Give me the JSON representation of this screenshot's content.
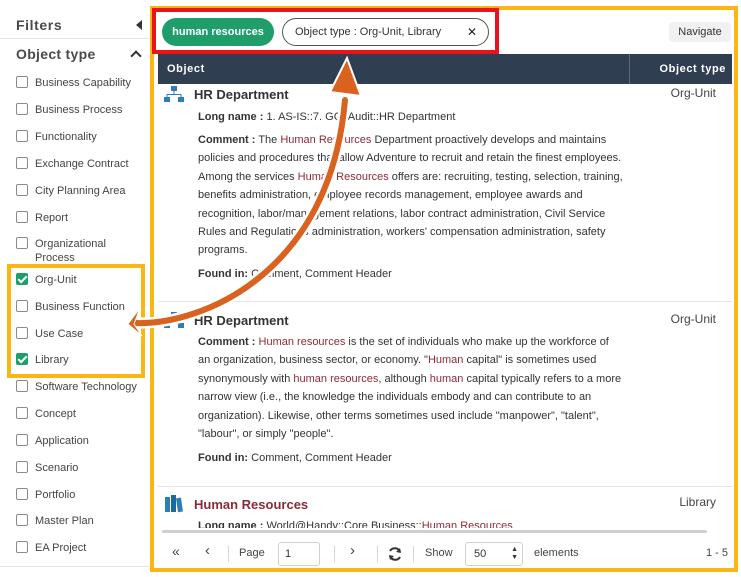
{
  "sidebar": {
    "title": "Filters",
    "section_title": "Object type",
    "filters": [
      {
        "label": "Business Capability",
        "checked": false
      },
      {
        "label": "Business Process",
        "checked": false
      },
      {
        "label": "Functionality",
        "checked": false
      },
      {
        "label": "Exchange Contract",
        "checked": false
      },
      {
        "label": "City Planning Area",
        "checked": false
      },
      {
        "label": "Report",
        "checked": false
      },
      {
        "label": "Organizational Process",
        "checked": false
      },
      {
        "label": "Org-Unit",
        "checked": true
      },
      {
        "label": "Business Function",
        "checked": false
      },
      {
        "label": "Use Case",
        "checked": false
      },
      {
        "label": "Library",
        "checked": true
      },
      {
        "label": "Software Technology",
        "checked": false
      },
      {
        "label": "Concept",
        "checked": false
      },
      {
        "label": "Application",
        "checked": false
      },
      {
        "label": "Scenario",
        "checked": false
      },
      {
        "label": "Portfolio",
        "checked": false
      },
      {
        "label": "Master Plan",
        "checked": false
      },
      {
        "label": "EA Project",
        "checked": false
      }
    ]
  },
  "filter_bar": {
    "search_tag": "human resources",
    "type_tag": "Object type : Org-Unit, Library",
    "close_glyph": "✕",
    "navigate_label": "Navigate"
  },
  "table": {
    "col_object": "Object",
    "col_type": "Object type"
  },
  "labels": {
    "long_name": "Long name :",
    "comment": "Comment :",
    "found_in": "Found in:"
  },
  "results": [
    {
      "title": "HR Department",
      "type": "Org-Unit",
      "long_name_a": "1. AS-IS::7. G",
      "long_name_b": "C::Audit::HR Department",
      "comment_pre": "The ",
      "comment_hl1": "Human Resources",
      "comment_mid": " Department proactively develops and maintains policies and procedures that allow Adventure to recruit and retain the finest employees. Among the services ",
      "comment_hl2": "Human Resources",
      "comment_post": " offers are: recruiting, testing, selection, training, benefits administration, employee records management, employee awards and recognition, labor/management relations, labor contract administration, Civil Service Rules and Regulations administration, workers' compensation administration, safety programs.",
      "found_in": "Comment, Comment Header"
    },
    {
      "title": "HR Department",
      "type": "Org-Unit",
      "c_hl1": "Human resources",
      "c_t1": " is the set of individuals who make up the workforce of an organization, business sector, or economy. \"",
      "c_hl2": "Human",
      "c_t2": " capital\" is sometimes used synonymously with ",
      "c_hl3": "human resources",
      "c_t3": ", although ",
      "c_hl4": "human",
      "c_t4": " capital typically refers to a more narrow view (i.e., the knowledge the individuals embody and can contribute to an organization). Likewise, other terms sometimes used include \"manpower\", \"talent\", \"labour\", or simply \"people\".",
      "found_in": "Comment, Comment Header"
    },
    {
      "title": "Human Resources",
      "type": "Library",
      "long_name_a": "World@Handy::Core Business::",
      "long_name_hl": "Human Resources"
    }
  ],
  "pager": {
    "first": "«",
    "prev": "‹",
    "page_label": "Page",
    "page_value": "1",
    "next": "›",
    "last": "»",
    "show_label": "Show",
    "show_value": "50",
    "elements_label": "elements",
    "range": "1 - 5"
  },
  "colors": {
    "accent_green": "#1f9d6b",
    "header_navy": "#2f3e50",
    "highlight": "#8b2b3a",
    "annotation_red": "#e8141a",
    "annotation_yellow": "#fbb614",
    "arrow_orange": "#d9621f"
  }
}
